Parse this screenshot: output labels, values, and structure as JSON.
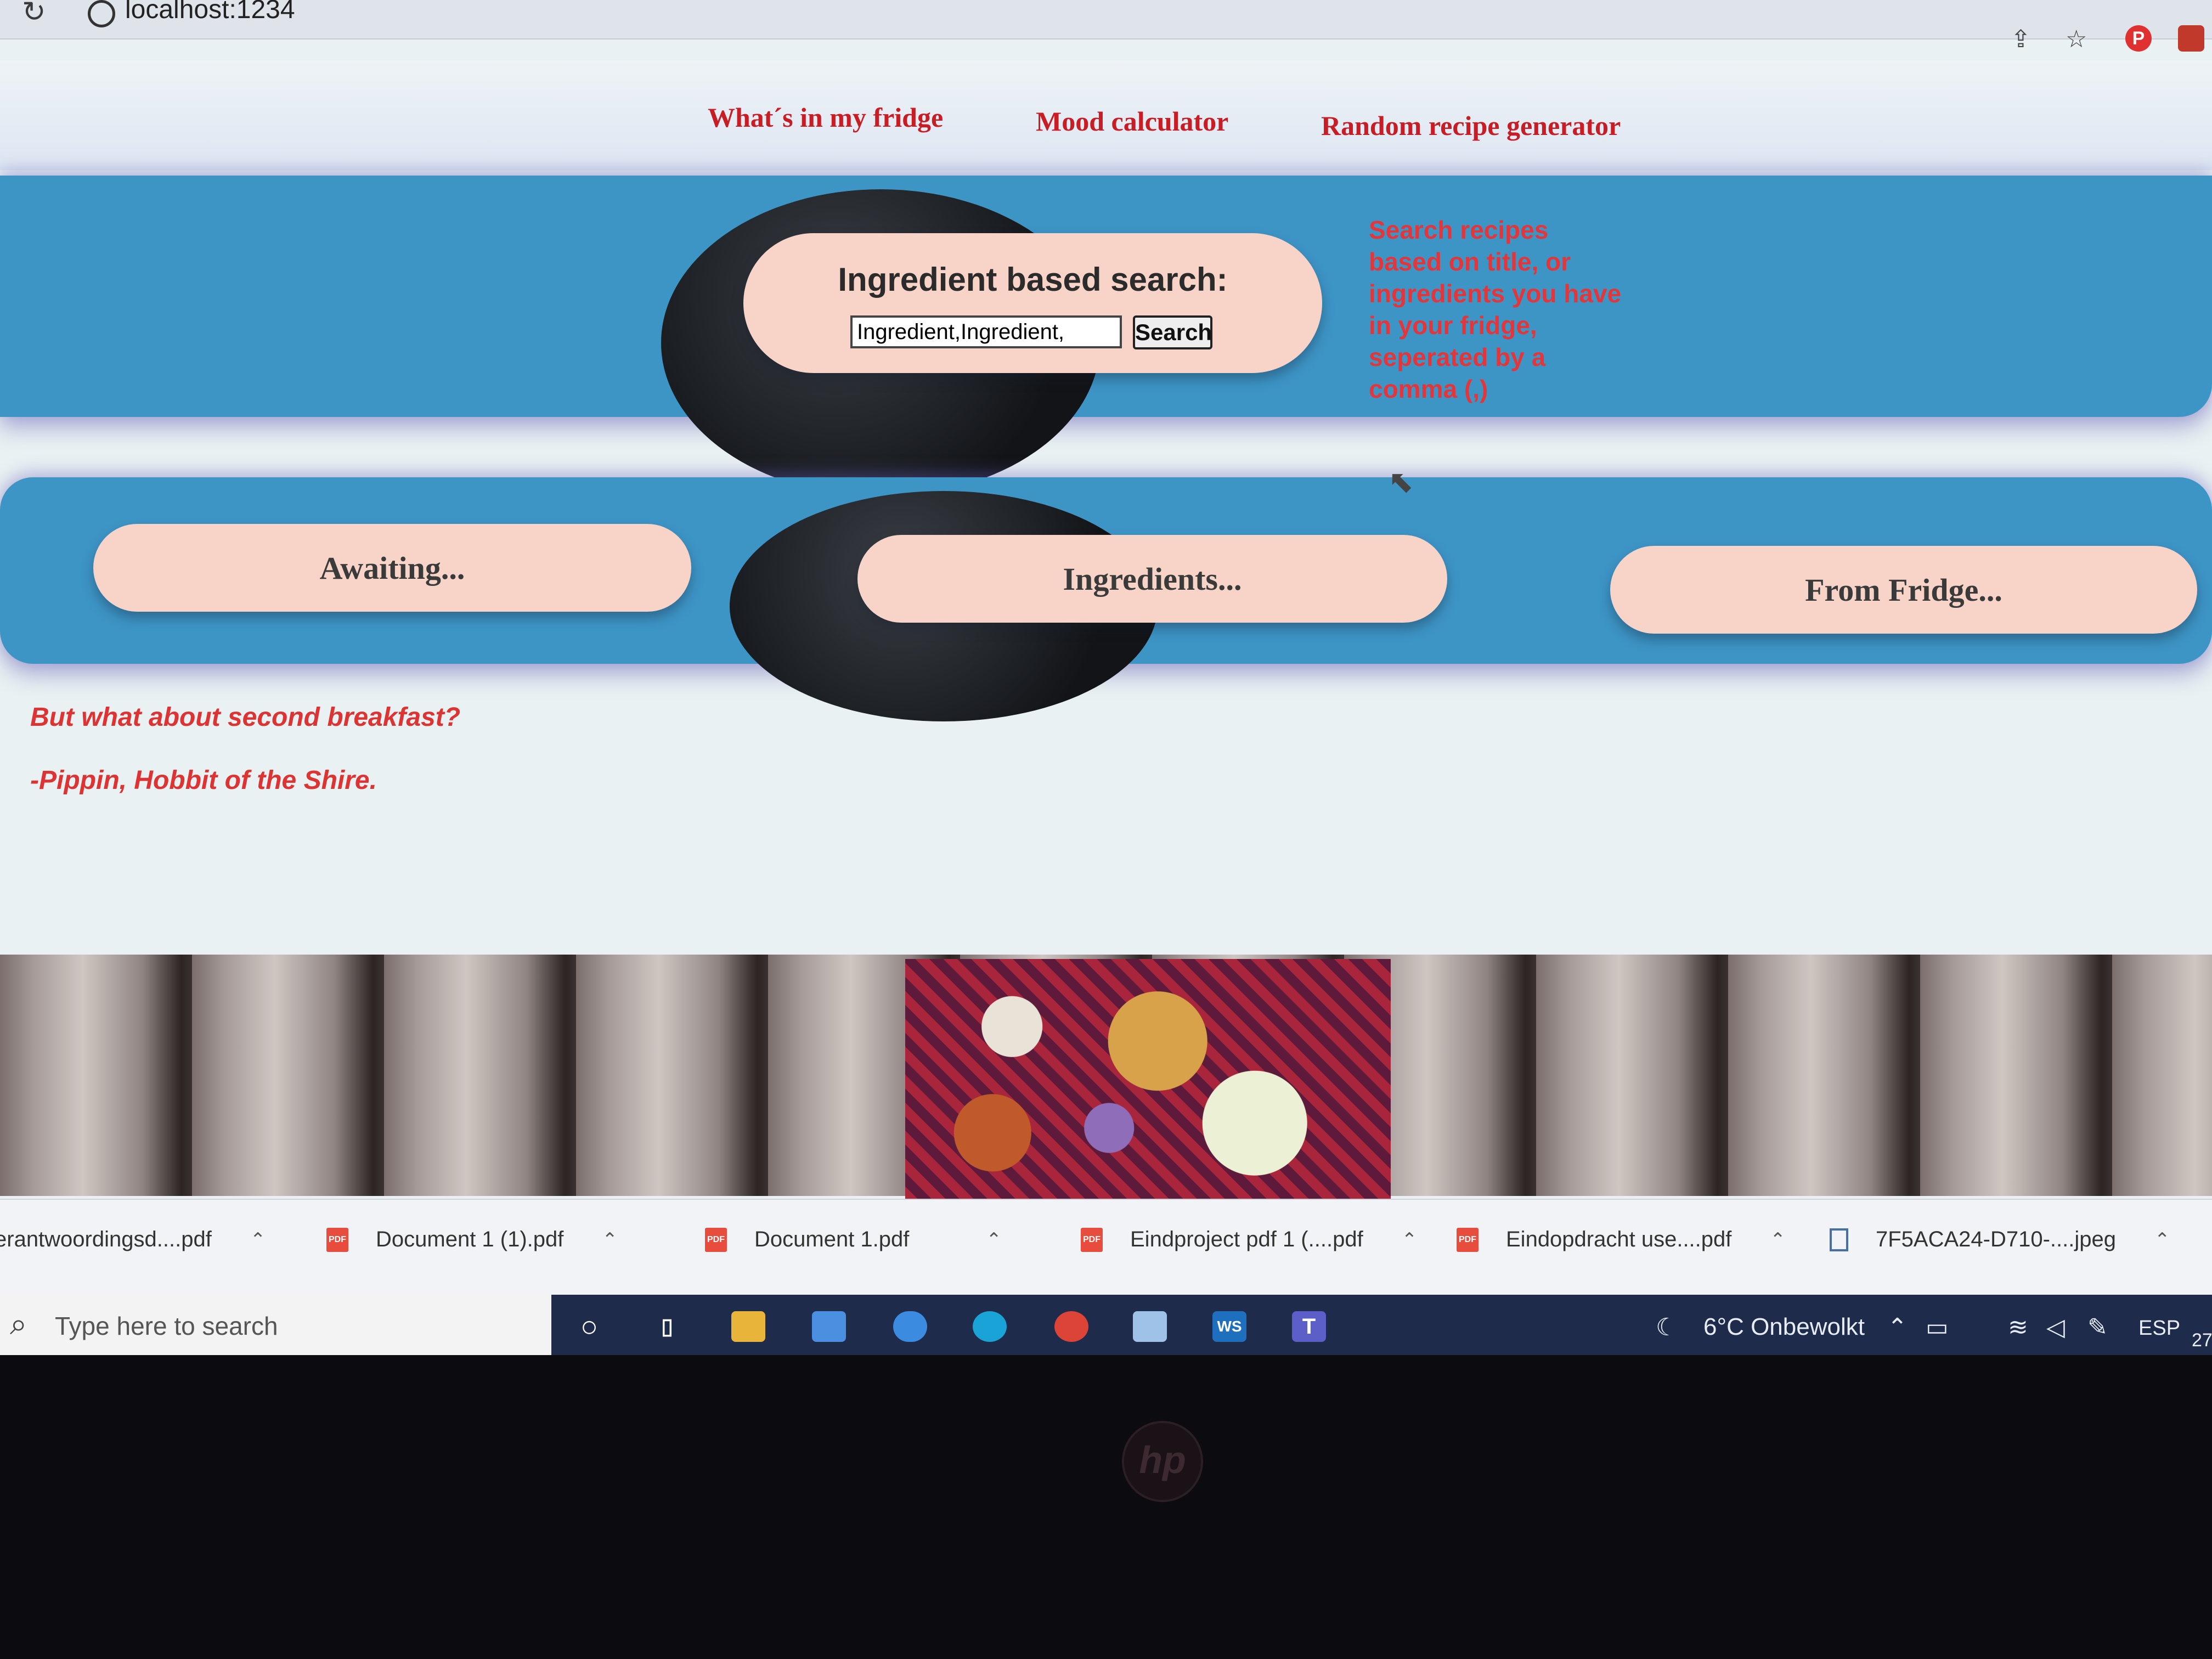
{
  "browser": {
    "url": "localhost:1234"
  },
  "nav": {
    "items": [
      "What´s in my fridge",
      "Mood calculator",
      "Random recipe generator"
    ]
  },
  "search": {
    "title": "Ingredient based search:",
    "input_value": "Ingredient,Ingredient,",
    "button_label": "Search",
    "hint": "Search recipes based on title, or ingredients you have in your fridge, seperated by a comma (,)"
  },
  "results": {
    "awaiting": "Awaiting...",
    "ingredients": "Ingredients...",
    "from_fridge": "From Fridge..."
  },
  "quote": {
    "line1": "But what about second breakfast?",
    "line2": "-Pippin, Hobbit of the Shire."
  },
  "downloads": [
    "erantwoordingsd....pdf",
    "Document 1 (1).pdf",
    "Document 1.pdf",
    "Eindproject pdf 1 (....pdf",
    "Eindopdracht use....pdf",
    "7F5ACA24-D710-....jpeg"
  ],
  "taskbar": {
    "search_placeholder": "Type here to search",
    "weather": "6°C  Onbewolkt",
    "language": "ESP",
    "clock_partial": "27",
    "app_ws": "WS",
    "app_teams": "T"
  },
  "colors": {
    "accent_red": "#c81d25",
    "band_blue": "#3d95c6",
    "card_peach": "#f8d4c8"
  }
}
